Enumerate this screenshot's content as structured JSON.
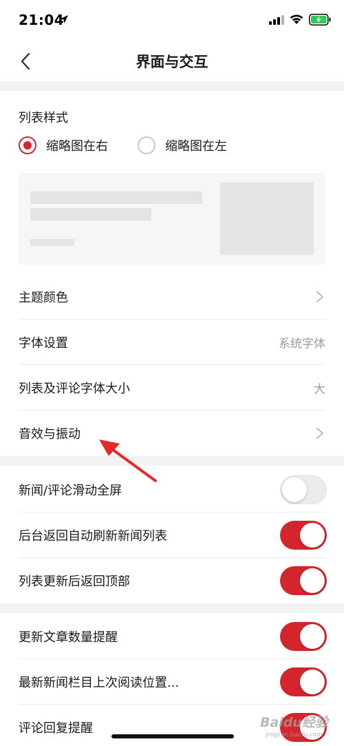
{
  "status_bar": {
    "time": "21:04",
    "icons": [
      "location-arrow-icon",
      "cellular-signal-icon",
      "wifi-icon",
      "battery-charging-icon"
    ],
    "battery_color": "#34c759"
  },
  "nav": {
    "title": "界面与交互",
    "back_icon": "chevron-left-icon"
  },
  "list_style": {
    "label": "列表样式",
    "options": [
      {
        "label": "缩略图在右",
        "selected": true
      },
      {
        "label": "缩略图在左",
        "selected": false
      }
    ]
  },
  "settings_rows": [
    {
      "label": "主题颜色",
      "value": "",
      "control": "chevron"
    },
    {
      "label": "字体设置",
      "value": "系统字体",
      "control": "value"
    },
    {
      "label": "列表及评论字体大小",
      "value": "大",
      "control": "value"
    },
    {
      "label": "音效与振动",
      "value": "",
      "control": "chevron"
    }
  ],
  "toggle_rows_1": [
    {
      "label": "新闻/评论滑动全屏",
      "on": false
    },
    {
      "label": "后台返回自动刷新新闻列表",
      "on": true
    },
    {
      "label": "列表更新后返回顶部",
      "on": true
    }
  ],
  "toggle_rows_2": [
    {
      "label": "更新文章数量提醒",
      "on": true
    },
    {
      "label": "最新新闻栏目上次阅读位置...",
      "on": true
    },
    {
      "label": "评论回复提醒",
      "on": true
    }
  ],
  "colors": {
    "accent": "#d4252c",
    "section_gap": "#f2f2f2",
    "annotation_arrow": "#e8262c"
  },
  "watermark": {
    "text": "Baidu经验",
    "sub": "jingyan.baidu.com"
  }
}
